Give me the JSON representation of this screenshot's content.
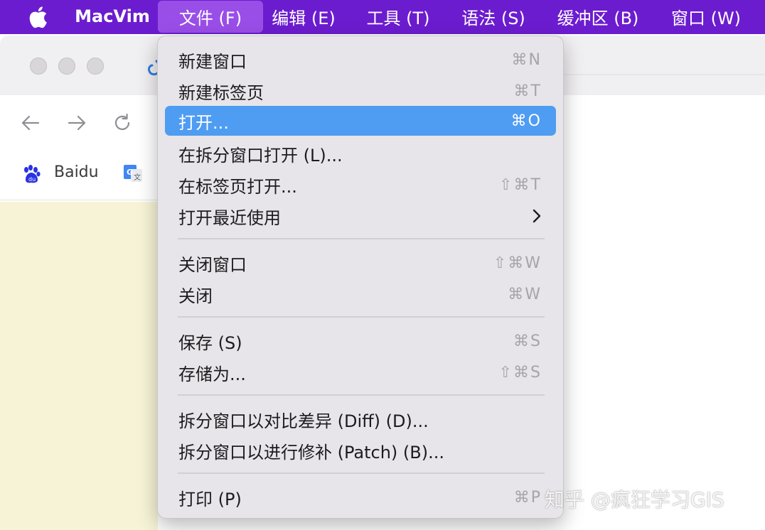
{
  "menubar": {
    "apple_icon": "apple-logo-icon",
    "app_name": "MacVim",
    "menus": [
      "文件 (F)",
      "编辑 (E)",
      "工具 (T)",
      "语法 (S)",
      "缓冲区 (B)",
      "窗口 (W)"
    ],
    "active_menu": "文件 (F)",
    "background_color": "#6c1ccf",
    "active_color": "#9a4ee8"
  },
  "browser": {
    "bookmarks": [
      {
        "label": "Baidu",
        "icon": "baidu-paw-icon"
      },
      {
        "label": "",
        "icon": "google-translate-icon"
      }
    ],
    "nav_icons": [
      "back-arrow-icon",
      "forward-arrow-icon",
      "reload-icon"
    ]
  },
  "file_menu": {
    "items": [
      {
        "label": "新建窗口",
        "shortcut": "⌘N"
      },
      {
        "label": "新建标签页",
        "shortcut": "⌘T"
      },
      {
        "label": "打开...",
        "shortcut": "⌘O",
        "highlighted": true
      },
      {
        "label": "在拆分窗口打开 (L)...",
        "shortcut": ""
      },
      {
        "label": "在标签页打开...",
        "shortcut": "⇧⌘T"
      },
      {
        "label": "打开最近使用",
        "shortcut": "",
        "submenu": true
      },
      {
        "label": "关闭窗口",
        "shortcut": "⇧⌘W"
      },
      {
        "label": "关闭",
        "shortcut": "⌘W"
      },
      {
        "label": "保存 (S)",
        "shortcut": "⌘S"
      },
      {
        "label": "存储为...",
        "shortcut": "⇧⌘S"
      },
      {
        "label": "拆分窗口以对比差异 (Diff) (D)...",
        "shortcut": ""
      },
      {
        "label": "拆分窗口以进行修补 (Patch) (B)...",
        "shortcut": ""
      },
      {
        "label": "打印 (P)",
        "shortcut": "⌘P"
      }
    ],
    "highlight_color": "#4f9cf3"
  },
  "watermark": "知乎 @疯狂学习GIS"
}
